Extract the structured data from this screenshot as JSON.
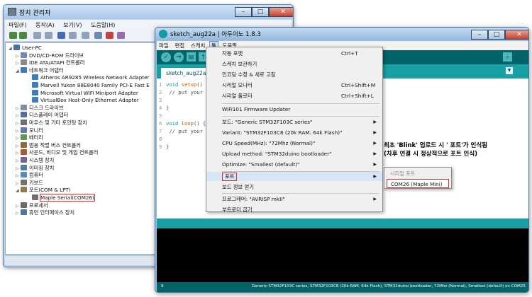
{
  "device_manager": {
    "title": "장치 관리자",
    "menu": [
      "파일(F)",
      "동작(A)",
      "보기(V)",
      "도움말(H)"
    ],
    "tree": {
      "root": "User-PC",
      "categories": [
        {
          "label": "DVD/CD-ROM 드라이브",
          "expanded": false
        },
        {
          "label": "IDE ATA/ATAPI 컨트롤러",
          "expanded": false
        },
        {
          "label": "네트워크 어댑터",
          "expanded": true,
          "children": [
            "Atheros AR9285 Wireless Network Adapter",
            "Marvell Yukon 88E8040 Family PCI-E Fast E",
            "Microsoft Virtual WiFi Miniport Adapter",
            "VirtualBox Host-Only Ethernet Adapter"
          ]
        },
        {
          "label": "디스크 드라이브",
          "expanded": false
        },
        {
          "label": "디스플레이 어댑터",
          "expanded": false
        },
        {
          "label": "마우스 및 기타 포인팅 장치",
          "expanded": false
        },
        {
          "label": "모니터",
          "expanded": false
        },
        {
          "label": "배터리",
          "expanded": false
        },
        {
          "label": "범용 직렬 버스 컨트롤러",
          "expanded": false
        },
        {
          "label": "사운드, 비디오 및 게임 컨트롤러",
          "expanded": false
        },
        {
          "label": "시스템 장치",
          "expanded": false
        },
        {
          "label": "이미징 장치",
          "expanded": false
        },
        {
          "label": "컴퓨터",
          "expanded": false
        },
        {
          "label": "키보드",
          "expanded": false
        },
        {
          "label": "포트(COM & LPT)",
          "expanded": true,
          "children": [
            "Maple Serial(COM26)"
          ]
        },
        {
          "label": "프로세서",
          "expanded": false
        },
        {
          "label": "휴먼 인터페이스 장치",
          "expanded": false
        }
      ]
    }
  },
  "arduino": {
    "title": "sketch_aug22a | 아두이노 1.8.3",
    "menu": [
      "파일",
      "편집",
      "스케치",
      "툴",
      "도움말"
    ],
    "active_menu": "툴",
    "tab": "sketch_aug22a",
    "code": [
      {
        "n": "1",
        "text": "void setup() {"
      },
      {
        "n": "2",
        "text": "  // put your"
      },
      {
        "n": "3",
        "text": ""
      },
      {
        "n": "4",
        "text": "}"
      },
      {
        "n": "5",
        "text": ""
      },
      {
        "n": "6",
        "text": "void loop() {"
      },
      {
        "n": "7",
        "text": "  // put your"
      },
      {
        "n": "8",
        "text": ""
      },
      {
        "n": "9",
        "text": "}"
      }
    ],
    "status_line": "9",
    "status_board": "Generic STM32F103C series, STM32F103C8 (20k RAM. 64k Flash), STM32duino bootloader, 72Mhz (Normal), Smallest (default) on COM25"
  },
  "tools_menu": {
    "items": [
      {
        "label": "자동 포맷",
        "shortcut": "Ctrl+T"
      },
      {
        "label": "스케치 보관하기"
      },
      {
        "label": "인코딩 수정 & 새로 고침"
      },
      {
        "label": "시리얼 모니터",
        "shortcut": "Ctrl+Shift+M"
      },
      {
        "label": "시리얼 플로터",
        "shortcut": "Ctrl+Shift+L"
      },
      {
        "label": "WiFi101 Firmware Updater"
      },
      {
        "label": "보드: \"Generic STM32F103C series\"",
        "submenu": true
      },
      {
        "label": "Variant: \"STM32F103C8 (20k RAM. 64k Flash)\"",
        "submenu": true
      },
      {
        "label": "CPU Speed(MHz): \"72Mhz (Normal)\"",
        "submenu": true
      },
      {
        "label": "Upload method: \"STM32duino bootloader\"",
        "submenu": true
      },
      {
        "label": "Optimize: \"Smallest (default)\"",
        "submenu": true
      },
      {
        "label": "포트",
        "submenu": true,
        "highlighted": true
      },
      {
        "label": "보드 정보 얻기"
      },
      {
        "label": "프로그래머: \"AVRISP mkII\"",
        "submenu": true
      },
      {
        "label": "부트로더 굽기"
      }
    ]
  },
  "port_submenu": {
    "header": "시리얼 포트",
    "selected": "COM26 (Maple Mini)"
  },
  "annotation": {
    "line1": "최초 'Blink' 업로드 시 ' 포트'가 인식됨",
    "line2": "(차후 연결 시 정상적으로 포트 인식)"
  },
  "colors": {
    "arduino_teal": "#006468",
    "arduino_tab_bar": "#17a1a5",
    "highlight_red": "#d23030"
  }
}
